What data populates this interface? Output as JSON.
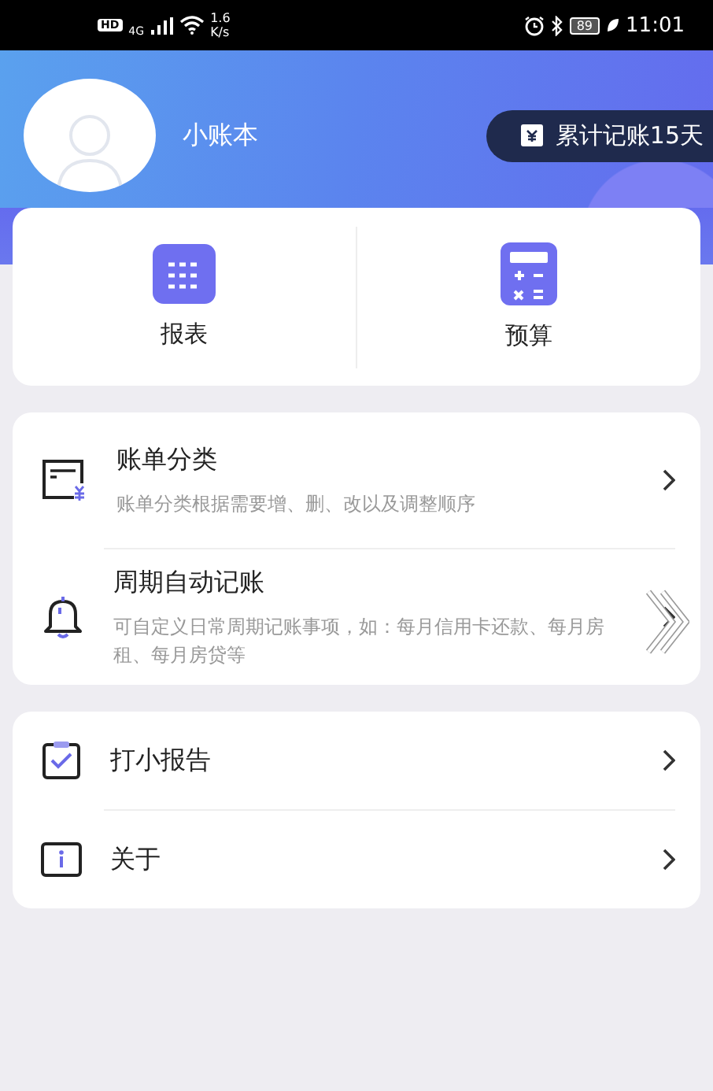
{
  "status_bar": {
    "hd": "HD",
    "network": "4G",
    "speed": "1.6",
    "speed_unit": "K/s",
    "battery": "89",
    "time": "11:01"
  },
  "profile": {
    "name": "小账本",
    "streak": "累计记账15天"
  },
  "shortcuts": [
    {
      "label": "报表",
      "kind": "report"
    },
    {
      "label": "预算",
      "kind": "budget"
    }
  ],
  "settings": [
    {
      "title": "账单分类",
      "description": "账单分类根据需要增、删、改以及调整顺序",
      "kind": "bill"
    },
    {
      "title": "周期自动记账",
      "description": "可自定义日常周期记账事项，如：每月信用卡还款、每月房租、每月房贷等",
      "kind": "bell"
    }
  ],
  "more": [
    {
      "title": "打小报告",
      "kind": "feedback"
    },
    {
      "title": "关于",
      "kind": "about"
    }
  ]
}
